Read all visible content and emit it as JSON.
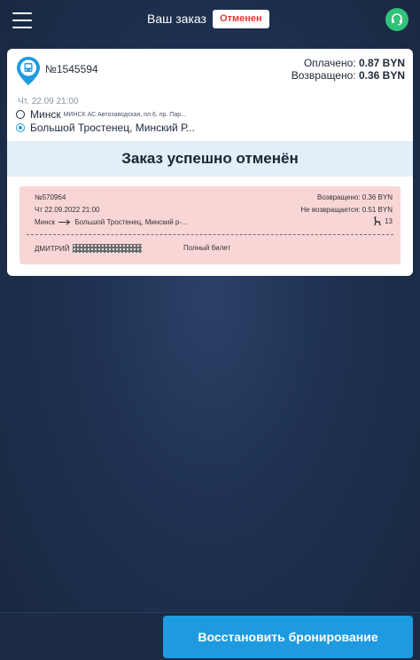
{
  "header": {
    "title": "Ваш заказ",
    "status_badge": "Отменен"
  },
  "order": {
    "number": "№1545594",
    "paid_label": "Оплачено:",
    "paid_value": "0.87 BYN",
    "refunded_label": "Возвращено:",
    "refunded_value": "0.36 BYN",
    "trip_date": "Чт. 22.09   21:00",
    "from_city": "Минск",
    "from_address": "МИНСК АС Автозаводская, пл.6, пр. Пар...",
    "to_city": "Большой Тростенец, Минский Р..."
  },
  "banner": {
    "text": "Заказ успешно отменён"
  },
  "ticket": {
    "number": "№570964",
    "date": "Чт 22.09.2022 21:00",
    "route_from": "Минск",
    "route_to": "Большой Тростенец, Минский р-...",
    "refunded": "Возвращено: 0.36 BYN",
    "non_refunded": "Не возвращается: 0.51 BYN",
    "seat": "13",
    "passenger": "ДМИТРИЙ",
    "ticket_type": "Полный билет"
  },
  "actions": {
    "restore_label": "Восстановить бронирование"
  },
  "colors": {
    "accent": "#1e9be0",
    "status": "#e53935",
    "support": "#2fc27a",
    "ticket_bg": "#f9d6d6",
    "banner_bg": "#e3eef9"
  },
  "icons": [
    "menu-icon",
    "support-icon",
    "bus-icon",
    "arrow-right-icon",
    "seat-icon"
  ]
}
